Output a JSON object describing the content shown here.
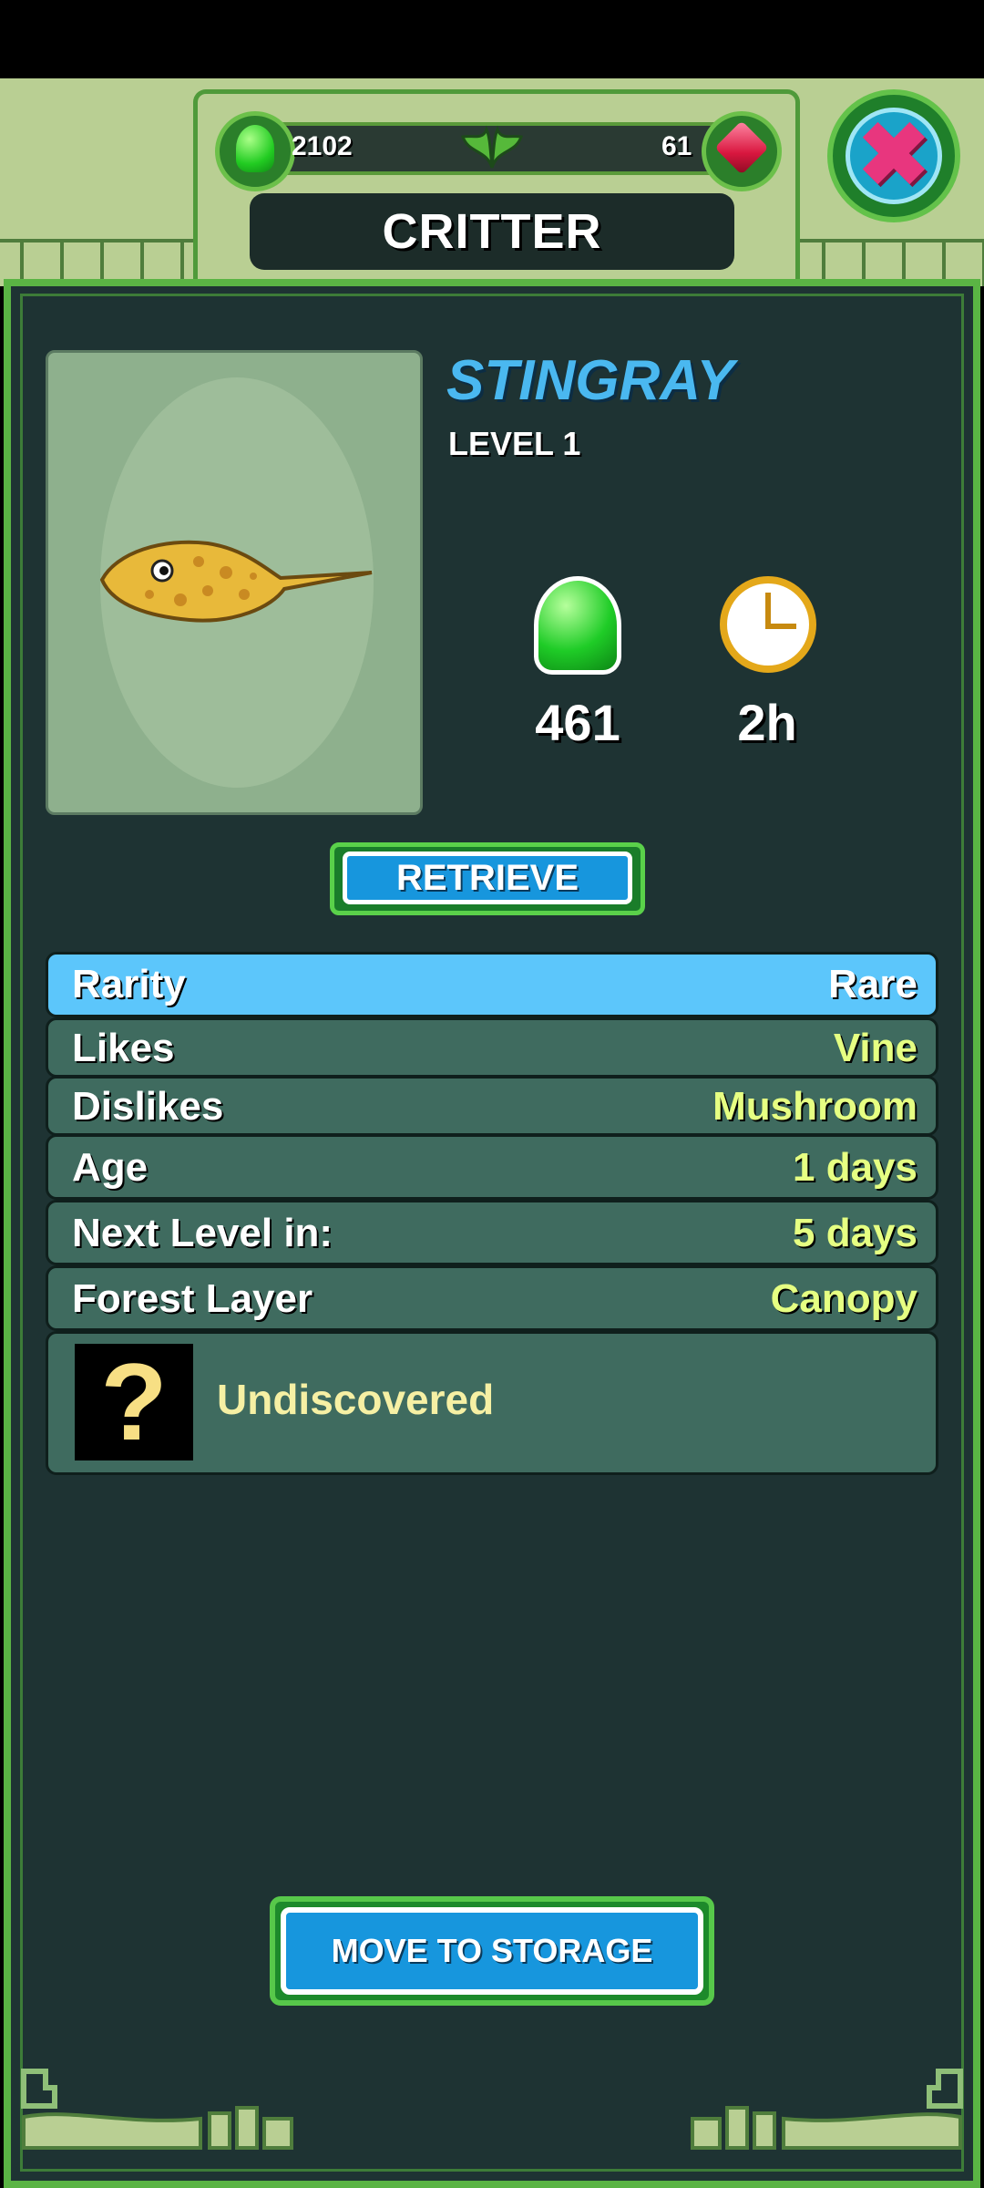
{
  "header": {
    "title": "CRITTER",
    "jelly_count": "2102",
    "gem_count": "61"
  },
  "critter": {
    "name": "STINGRAY",
    "level": "LEVEL 1",
    "jelly_value": "461",
    "time": "2h"
  },
  "buttons": {
    "retrieve": "RETRIEVE",
    "move_to_storage": "MOVE TO STORAGE"
  },
  "details": [
    {
      "label": "Rarity",
      "value": "Rare"
    },
    {
      "label": "Likes",
      "value": "Vine"
    },
    {
      "label": "Dislikes",
      "value": "Mushroom"
    },
    {
      "label": "Age",
      "value": "1 days"
    },
    {
      "label": "Next Level in:",
      "value": "5 days"
    },
    {
      "label": "Forest Layer",
      "value": "Canopy"
    }
  ],
  "undiscovered": {
    "icon_text": "?",
    "label": "Undiscovered"
  },
  "colors": {
    "panel": "#1e3333",
    "frame_green": "#5ab444",
    "rarity_highlight": "#5cc6fb",
    "value_yellow": "#e6ff82",
    "button_blue": "#1796dd"
  }
}
